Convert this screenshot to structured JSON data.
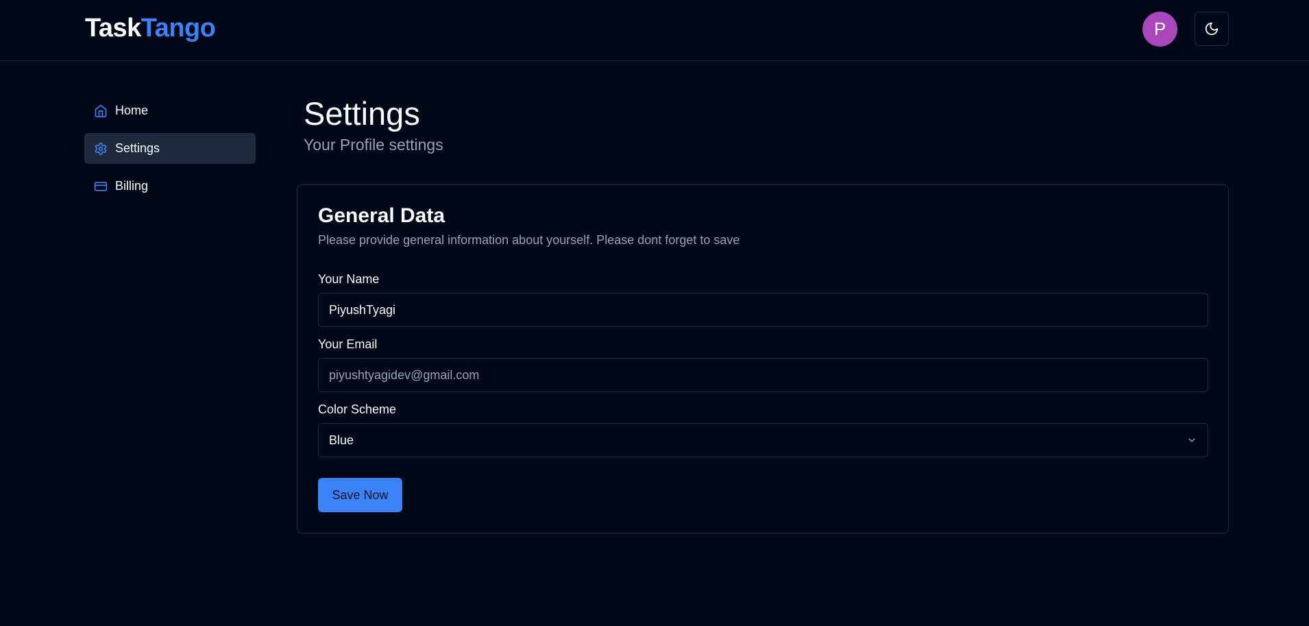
{
  "app": {
    "logo_part1": "Task",
    "logo_part2": "Tango",
    "avatar_initial": "P",
    "brand_color": "#3b82f6",
    "avatar_color": "#ab47bc",
    "theme_toggle_icon": "moon-icon"
  },
  "sidebar": {
    "items": [
      {
        "label": "Home",
        "icon": "home-icon",
        "active": false
      },
      {
        "label": "Settings",
        "icon": "gear-icon",
        "active": true
      },
      {
        "label": "Billing",
        "icon": "credit-card-icon",
        "active": false
      }
    ]
  },
  "main": {
    "title": "Settings",
    "subtitle": "Your Profile settings"
  },
  "card": {
    "title": "General Data",
    "description": "Please provide general information about yourself. Please dont forget to save",
    "name_label": "Your Name",
    "name_value": "PiyushTyagi",
    "email_label": "Your Email",
    "email_placeholder": "piyushtyagidev@gmail.com",
    "color_scheme_label": "Color Scheme",
    "color_scheme_value": "Blue",
    "save_label": "Save Now"
  }
}
